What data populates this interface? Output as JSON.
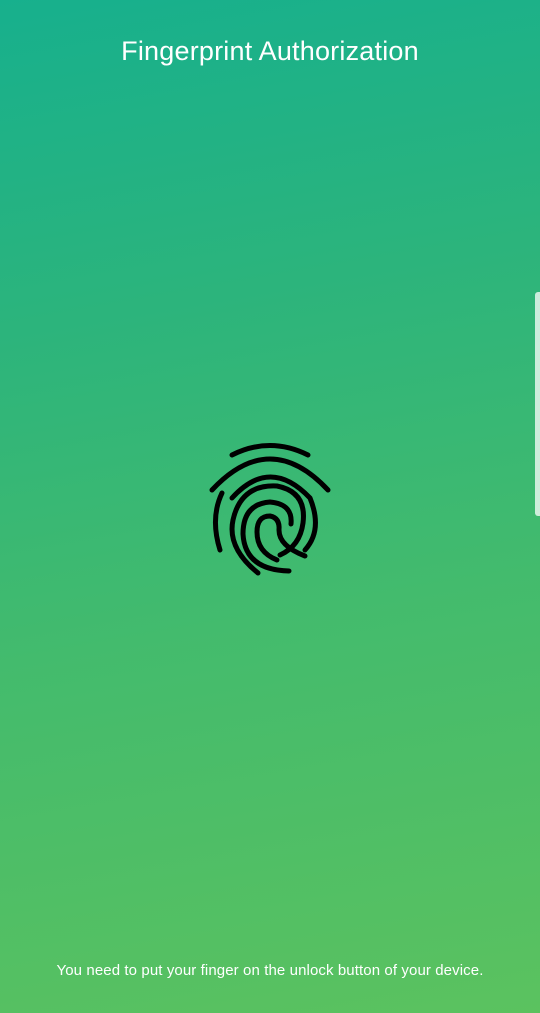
{
  "screen": {
    "title": "Fingerprint Authorization",
    "hint": "You need to put your finger on the unlock button of your device.",
    "icon": "fingerprint-icon"
  },
  "colors": {
    "gradient_top": "#17b08d",
    "gradient_bottom": "#5bc25f",
    "text": "#ffffff",
    "icon": "#000000"
  }
}
